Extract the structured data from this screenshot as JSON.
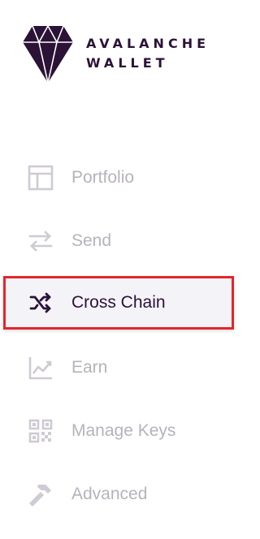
{
  "brand": {
    "line1": "AVALANCHE",
    "line2": "WALLET",
    "logo_icon": "diamond-logo-icon"
  },
  "colors": {
    "brand": "#2b1237",
    "inactive": "#b7b2bb",
    "active_bg": "#f4f3f8",
    "highlight": "#e3262b"
  },
  "nav": {
    "items": [
      {
        "label": "Portfolio",
        "icon": "portfolio-icon",
        "active": false
      },
      {
        "label": "Send",
        "icon": "send-arrows-icon",
        "active": false
      },
      {
        "label": "Cross Chain",
        "icon": "shuffle-icon",
        "active": true
      },
      {
        "label": "Earn",
        "icon": "chart-icon",
        "active": false
      },
      {
        "label": "Manage Keys",
        "icon": "qr-code-icon",
        "active": false
      },
      {
        "label": "Advanced",
        "icon": "hammer-icon",
        "active": false
      }
    ]
  }
}
